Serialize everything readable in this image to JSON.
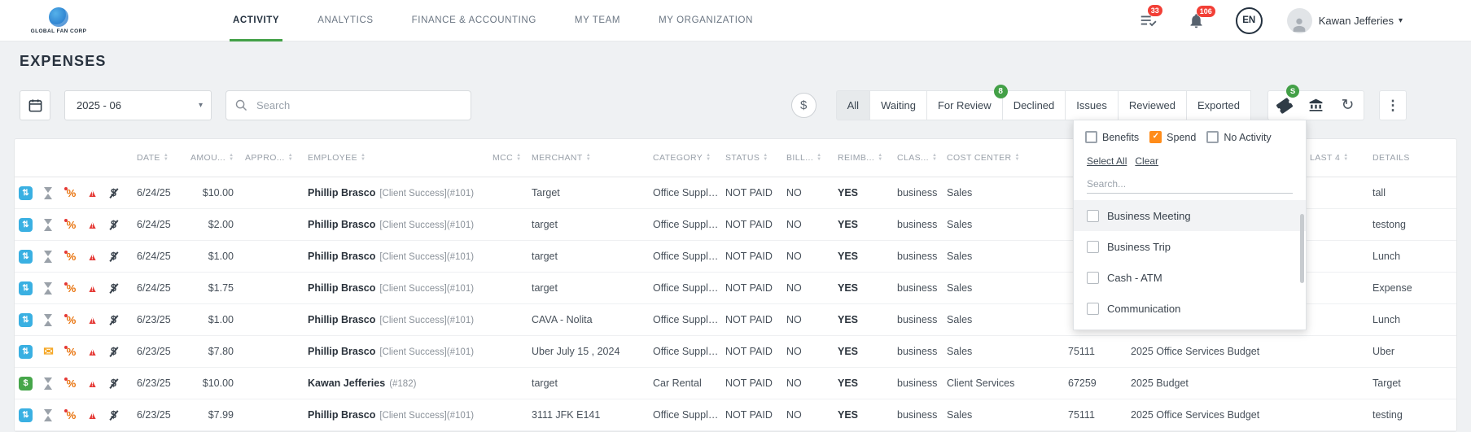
{
  "colors": {
    "accent_green": "#43a047",
    "badge_red": "#f23f36",
    "checkbox_orange": "#ff8c1a",
    "brand_navy": "#24313f"
  },
  "glyphs": {
    "caret_down": "▾",
    "refresh": "↻",
    "kebab": "⋮",
    "dollar": "$"
  },
  "topbar": {
    "logo_text": "GLOBAL FAN CORP",
    "nav": [
      {
        "label": "ACTIVITY",
        "active": true
      },
      {
        "label": "ANALYTICS"
      },
      {
        "label": "FINANCE & ACCOUNTING"
      },
      {
        "label": "MY TEAM"
      },
      {
        "label": "MY ORGANIZATION"
      }
    ],
    "queue_badge": "33",
    "notifications_badge": "106",
    "language": "EN",
    "user_name": "Kawan Jefferies"
  },
  "page": {
    "title": "EXPENSES"
  },
  "toolbar": {
    "period": "2025 - 06",
    "search_placeholder": "Search",
    "tabs": [
      {
        "label": "All",
        "selected": true
      },
      {
        "label": "Waiting"
      },
      {
        "label": "For Review",
        "badge": "8"
      },
      {
        "label": "Declined"
      },
      {
        "label": "Issues"
      },
      {
        "label": "Reviewed"
      },
      {
        "label": "Exported"
      }
    ],
    "filter_button_badge": "S"
  },
  "filter_panel": {
    "types": [
      {
        "label": "Benefits",
        "checked": false
      },
      {
        "label": "Spend",
        "checked": true
      },
      {
        "label": "No Activity",
        "checked": false
      }
    ],
    "select_all_label": "Select All",
    "clear_label": "Clear",
    "search_placeholder": "Search...",
    "options": [
      {
        "label": "Business Meeting",
        "highlighted": true
      },
      {
        "label": "Business Trip"
      },
      {
        "label": "Cash - ATM"
      },
      {
        "label": "Communication"
      }
    ]
  },
  "table": {
    "columns": [
      {
        "key": "icons",
        "label": "",
        "sort": false
      },
      {
        "key": "date",
        "label": "DATE",
        "sort": true
      },
      {
        "key": "amount",
        "label": "AMOU...",
        "sort": true
      },
      {
        "key": "approved",
        "label": "APPRO...",
        "sort": true
      },
      {
        "key": "employee",
        "label": "EMPLOYEE",
        "sort": true
      },
      {
        "key": "mcc",
        "label": "MCC",
        "sort": true
      },
      {
        "key": "merchant",
        "label": "MERCHANT",
        "sort": true
      },
      {
        "key": "category",
        "label": "CATEGORY",
        "sort": true
      },
      {
        "key": "status",
        "label": "STATUS",
        "sort": true
      },
      {
        "key": "billable",
        "label": "BILL...",
        "sort": true
      },
      {
        "key": "reimb",
        "label": "REIMB...",
        "sort": true
      },
      {
        "key": "class",
        "label": "CLAS...",
        "sort": true
      },
      {
        "key": "cost_center",
        "label": "COST CENTER",
        "sort": true
      },
      {
        "key": "code",
        "label": "",
        "sort": false
      },
      {
        "key": "budget",
        "label": "",
        "sort": false
      },
      {
        "key": "last4",
        "label": "LAST 4",
        "sort": true
      },
      {
        "key": "details",
        "label": "DETAILS",
        "sort": false
      }
    ],
    "rows": [
      {
        "icons": {
          "type": "card",
          "status": "hourglass"
        },
        "date": "6/24/25",
        "amount": "$10.00",
        "approved": "",
        "employee": {
          "name": "Phillip Brasco",
          "sub": "[Client Success](#101)"
        },
        "mcc": "",
        "merchant": "Target",
        "category": "Office Supplies",
        "status": "NOT PAID",
        "billable": "NO",
        "reimb": "YES",
        "class": "business",
        "cost_center": "Sales",
        "code": "",
        "budget": "",
        "last4": "",
        "details": "tall"
      },
      {
        "icons": {
          "type": "card",
          "status": "hourglass"
        },
        "date": "6/24/25",
        "amount": "$2.00",
        "approved": "",
        "employee": {
          "name": "Phillip Brasco",
          "sub": "[Client Success](#101)"
        },
        "mcc": "",
        "merchant": "target",
        "category": "Office Supplies",
        "status": "NOT PAID",
        "billable": "NO",
        "reimb": "YES",
        "class": "business",
        "cost_center": "Sales",
        "code": "",
        "budget": "",
        "last4": "",
        "details": "testong"
      },
      {
        "icons": {
          "type": "card",
          "status": "hourglass"
        },
        "date": "6/24/25",
        "amount": "$1.00",
        "approved": "",
        "employee": {
          "name": "Phillip Brasco",
          "sub": "[Client Success](#101)"
        },
        "mcc": "",
        "merchant": "target",
        "category": "Office Supplies",
        "status": "NOT PAID",
        "billable": "NO",
        "reimb": "YES",
        "class": "business",
        "cost_center": "Sales",
        "code": "",
        "budget": "",
        "last4": "",
        "details": "Lunch"
      },
      {
        "icons": {
          "type": "card",
          "status": "hourglass"
        },
        "date": "6/24/25",
        "amount": "$1.75",
        "approved": "",
        "employee": {
          "name": "Phillip Brasco",
          "sub": "[Client Success](#101)"
        },
        "mcc": "",
        "merchant": "target",
        "category": "Office Supplies",
        "status": "NOT PAID",
        "billable": "NO",
        "reimb": "YES",
        "class": "business",
        "cost_center": "Sales",
        "code": "",
        "budget": "",
        "last4": "",
        "details": "Expense"
      },
      {
        "icons": {
          "type": "card",
          "status": "hourglass"
        },
        "date": "6/23/25",
        "amount": "$1.00",
        "approved": "",
        "employee": {
          "name": "Phillip Brasco",
          "sub": "[Client Success](#101)"
        },
        "mcc": "",
        "merchant": "CAVA - Nolita",
        "category": "Office Supplies",
        "status": "NOT PAID",
        "billable": "NO",
        "reimb": "YES",
        "class": "business",
        "cost_center": "Sales",
        "code": "",
        "budget": "",
        "last4": "",
        "details": "Lunch"
      },
      {
        "icons": {
          "type": "card",
          "status": "envelope"
        },
        "date": "6/23/25",
        "amount": "$7.80",
        "approved": "",
        "employee": {
          "name": "Phillip Brasco",
          "sub": "[Client Success](#101)"
        },
        "mcc": "",
        "merchant": "Uber July 15 , 2024",
        "category": "Office Supplies",
        "status": "NOT PAID",
        "billable": "NO",
        "reimb": "YES",
        "class": "business",
        "cost_center": "Sales",
        "code": "75111",
        "budget": "2025 Office Services Budget",
        "last4": "",
        "details": "Uber"
      },
      {
        "icons": {
          "type": "cash",
          "status": "hourglass"
        },
        "date": "6/23/25",
        "amount": "$10.00",
        "approved": "",
        "employee": {
          "name": "Kawan Jefferies",
          "sub": "(#182)"
        },
        "mcc": "",
        "merchant": "target",
        "category": "Car Rental",
        "status": "NOT PAID",
        "billable": "NO",
        "reimb": "YES",
        "class": "business",
        "cost_center": "Client Services",
        "code": "67259",
        "budget": "2025 Budget",
        "last4": "",
        "details": "Target"
      },
      {
        "icons": {
          "type": "card",
          "status": "hourglass"
        },
        "date": "6/23/25",
        "amount": "$7.99",
        "approved": "",
        "employee": {
          "name": "Phillip Brasco",
          "sub": "[Client Success](#101)"
        },
        "mcc": "",
        "merchant": "3111 JFK E141",
        "category": "Office Supplies",
        "status": "NOT PAID",
        "billable": "NO",
        "reimb": "YES",
        "class": "business",
        "cost_center": "Sales",
        "code": "75111",
        "budget": "2025 Office Services Budget",
        "last4": "",
        "details": "testing"
      }
    ]
  }
}
